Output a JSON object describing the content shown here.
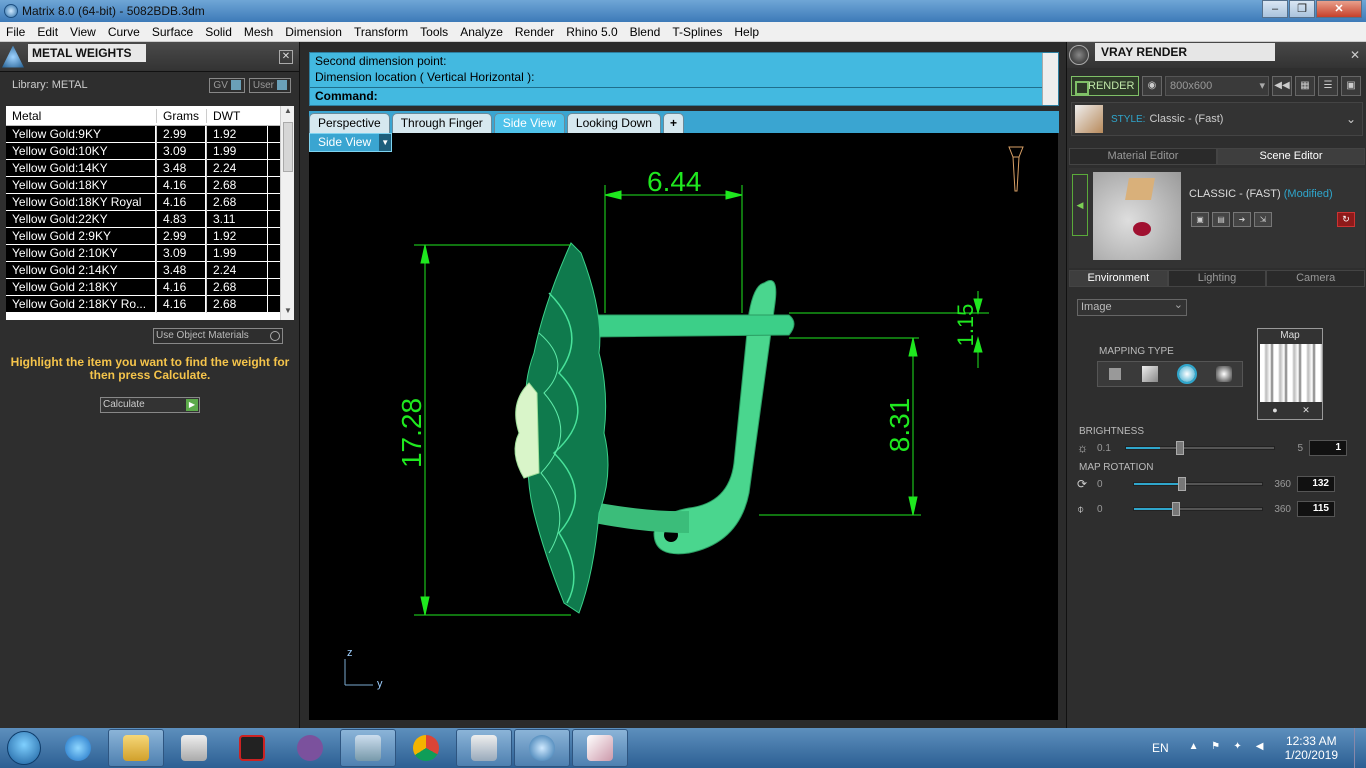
{
  "window": {
    "title": "Matrix 8.0 (64-bit) - 5082BDB.3dm",
    "btn_min": "–",
    "btn_max": "❐",
    "btn_close": "✕"
  },
  "menu": [
    "File",
    "Edit",
    "View",
    "Curve",
    "Surface",
    "Solid",
    "Mesh",
    "Dimension",
    "Transform",
    "Tools",
    "Analyze",
    "Render",
    "Rhino 5.0",
    "Blend",
    "T-Splines",
    "Help"
  ],
  "metal_weights": {
    "title": "METAL WEIGHTS",
    "library_label": "Library: METAL",
    "gv_label": "GV",
    "user_label": "User",
    "columns": [
      "Metal",
      "Grams",
      "DWT"
    ],
    "rows": [
      [
        "Yellow Gold:9KY",
        "2.99",
        "1.92"
      ],
      [
        "Yellow Gold:10KY",
        "3.09",
        "1.99"
      ],
      [
        "Yellow Gold:14KY",
        "3.48",
        "2.24"
      ],
      [
        "Yellow Gold:18KY",
        "4.16",
        "2.68"
      ],
      [
        "Yellow Gold:18KY Royal",
        "4.16",
        "2.68"
      ],
      [
        "Yellow Gold:22KY",
        "4.83",
        "3.11"
      ],
      [
        "Yellow Gold 2:9KY",
        "2.99",
        "1.92"
      ],
      [
        "Yellow Gold 2:10KY",
        "3.09",
        "1.99"
      ],
      [
        "Yellow Gold 2:14KY",
        "3.48",
        "2.24"
      ],
      [
        "Yellow Gold 2:18KY",
        "4.16",
        "2.68"
      ],
      [
        "Yellow Gold 2:18KY Ro...",
        "4.16",
        "2.68"
      ]
    ],
    "use_object_materials": "Use Object Materials",
    "hint": "Highlight the item you want to find the weight for then press Calculate.",
    "calculate": "Calculate"
  },
  "command": {
    "line1": "Second dimension point:",
    "line2": "Dimension location ( Vertical  Horizontal ):",
    "prompt": "Command:"
  },
  "view_tabs": [
    "Perspective",
    "Through Finger",
    "Side View",
    "Looking Down"
  ],
  "active_tab": "Side View",
  "viewport": {
    "label": "Side View",
    "dim_width": "6.44",
    "dim_height": "17.28",
    "dim_right": "8.31",
    "dim_small": "1.15",
    "axis_z": "z",
    "axis_y": "y",
    "model_color": "#2ec27e",
    "dim_color": "#1fe81f"
  },
  "vray": {
    "title": "VRAY RENDER",
    "render_btn": "RENDER",
    "resolution": "800x600",
    "style_label": "STYLE:",
    "style_value": "Classic - (Fast)",
    "tabs": [
      "Material Editor",
      "Scene Editor"
    ],
    "active_tab": "Scene Editor",
    "scene_name": "CLASSIC - (FAST)",
    "scene_modified": "(Modified)",
    "env_tabs": [
      "Environment",
      "Lighting",
      "Camera"
    ],
    "env_active": "Environment",
    "image_select": "Image",
    "map_label": "Map",
    "mapping_type": "MAPPING TYPE",
    "brightness": {
      "label": "BRIGHTNESS",
      "min": "0.1",
      "max": "5",
      "value": "1"
    },
    "map_rotation": {
      "label": "MAP ROTATION",
      "min": "0",
      "max": "360",
      "value1": "132",
      "value2": "115"
    }
  },
  "taskbar": {
    "lang": "EN",
    "time": "12:33 AM",
    "date": "1/20/2019"
  }
}
